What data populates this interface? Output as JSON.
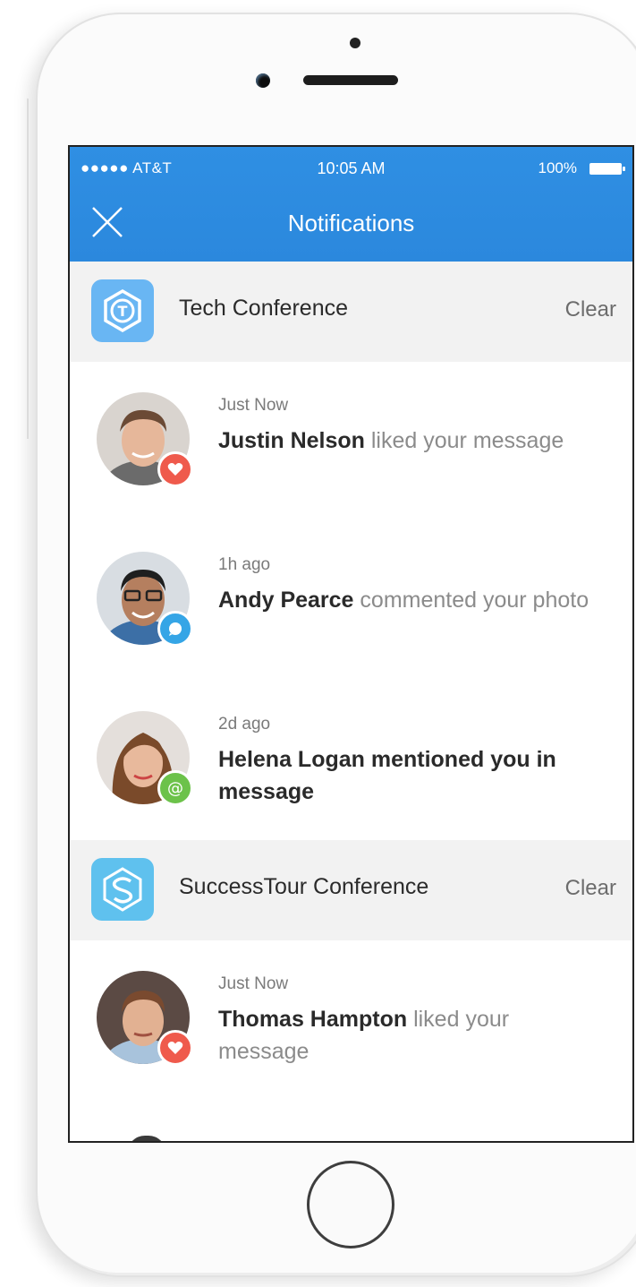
{
  "status": {
    "carrier": "●●●●● AT&T",
    "time": "10:05 AM",
    "battery": "100%"
  },
  "nav": {
    "title": "Notifications"
  },
  "groups": [
    {
      "name": "Tech Conference",
      "clear_label": "Clear",
      "logo_letter": "T",
      "logo_color": "#69b6f3",
      "notifications": [
        {
          "time": "Just Now",
          "name": "Justin Nelson",
          "action": "liked your message",
          "badge": "heart-icon",
          "badge_color": "#ef5a4c"
        },
        {
          "time": "1h ago",
          "name": "Andy Pearce",
          "action": "commented your photo",
          "badge": "comment-icon",
          "badge_color": "#35a5e6"
        },
        {
          "time": "2d ago",
          "text": "Helena Logan mentioned you in message",
          "badge": "at-icon",
          "badge_color": "#6cc24a"
        }
      ]
    },
    {
      "name": "SuccessTour Conference",
      "clear_label": "Clear",
      "logo_color": "#5fc1ee",
      "notifications": [
        {
          "time": "Just Now",
          "name": "Thomas Hampton",
          "action": "liked your message",
          "badge": "heart-icon",
          "badge_color": "#ef5a4c"
        }
      ]
    }
  ],
  "colors": {
    "header_blue": "#2d8be0",
    "group_bg": "#f2f2f2"
  }
}
